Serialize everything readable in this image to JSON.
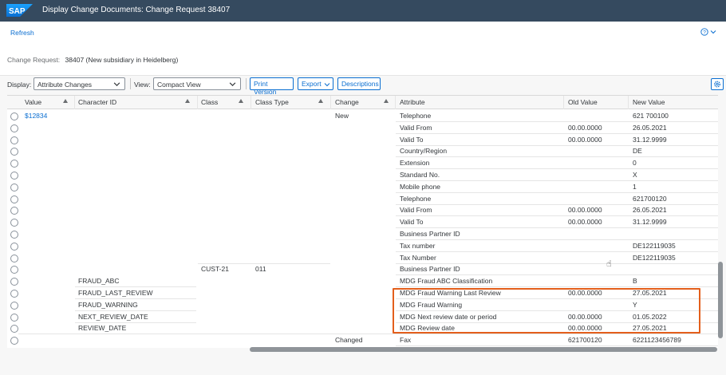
{
  "app": {
    "title": "Display Change Documents: Change Request 38407",
    "logo_text": "SAP"
  },
  "toolbar": {
    "refresh_label": "Refresh",
    "help_icon": "help-icon"
  },
  "change_request": {
    "label": "Change Request:",
    "value": "38407 (New subsidiary in Heidelberg)"
  },
  "filters": {
    "display_label": "Display:",
    "display_value": "Attribute Changes",
    "view_label": "View:",
    "view_value": "Compact View",
    "print_label": "Print Version",
    "export_label": "Export",
    "descriptions_label": "Descriptions"
  },
  "table": {
    "columns": [
      "Value",
      "Character ID",
      "Class",
      "Class Type",
      "Change",
      "Attribute",
      "Old Value",
      "New Value"
    ],
    "rows": [
      {
        "value": "$12834",
        "char": "",
        "class": "",
        "ctype": "",
        "change": "New",
        "attr": "Telephone",
        "old": "",
        "new": "621 700100"
      },
      {
        "value": "",
        "char": "",
        "class": "",
        "ctype": "",
        "change": "",
        "attr": "Valid From",
        "old": "00.00.0000",
        "new": "26.05.2021"
      },
      {
        "value": "",
        "char": "",
        "class": "",
        "ctype": "",
        "change": "",
        "attr": "Valid To",
        "old": "00.00.0000",
        "new": "31.12.9999"
      },
      {
        "value": "",
        "char": "",
        "class": "",
        "ctype": "",
        "change": "",
        "attr": "Country/Region",
        "old": "",
        "new": "DE"
      },
      {
        "value": "",
        "char": "",
        "class": "",
        "ctype": "",
        "change": "",
        "attr": "Extension",
        "old": "",
        "new": "0"
      },
      {
        "value": "",
        "char": "",
        "class": "",
        "ctype": "",
        "change": "",
        "attr": "Standard No.",
        "old": "",
        "new": "X"
      },
      {
        "value": "",
        "char": "",
        "class": "",
        "ctype": "",
        "change": "",
        "attr": "Mobile phone",
        "old": "",
        "new": "1"
      },
      {
        "value": "",
        "char": "",
        "class": "",
        "ctype": "",
        "change": "",
        "attr": "Telephone",
        "old": "",
        "new": "621700120"
      },
      {
        "value": "",
        "char": "",
        "class": "",
        "ctype": "",
        "change": "",
        "attr": "Valid From",
        "old": "00.00.0000",
        "new": "26.05.2021"
      },
      {
        "value": "",
        "char": "",
        "class": "",
        "ctype": "",
        "change": "",
        "attr": "Valid To",
        "old": "00.00.0000",
        "new": "31.12.9999"
      },
      {
        "value": "",
        "char": "",
        "class": "",
        "ctype": "",
        "change": "",
        "attr": "Business Partner ID",
        "old": "",
        "new": ""
      },
      {
        "value": "",
        "char": "",
        "class": "",
        "ctype": "",
        "change": "",
        "attr": "Tax number",
        "old": "",
        "new": "DE122119035"
      },
      {
        "value": "",
        "char": "",
        "class": "",
        "ctype": "",
        "change": "",
        "attr": "Tax Number",
        "old": "",
        "new": "DE122119035"
      },
      {
        "value": "",
        "char": "",
        "class": "CUST-21",
        "ctype": "011",
        "change": "",
        "attr": "Business Partner ID",
        "old": "",
        "new": ""
      },
      {
        "value": "",
        "char": "FRAUD_ABC",
        "class": "",
        "ctype": "",
        "change": "",
        "attr": "MDG Fraud ABC Classification",
        "old": "",
        "new": "B"
      },
      {
        "value": "",
        "char": "FRAUD_LAST_REVIEW",
        "class": "",
        "ctype": "",
        "change": "",
        "attr": "MDG Fraud Warning Last Review",
        "old": "00.00.0000",
        "new": "27.05.2021"
      },
      {
        "value": "",
        "char": "FRAUD_WARNING",
        "class": "",
        "ctype": "",
        "change": "",
        "attr": "MDG Fraud Warning",
        "old": "",
        "new": "Y"
      },
      {
        "value": "",
        "char": "NEXT_REVIEW_DATE",
        "class": "",
        "ctype": "",
        "change": "",
        "attr": "MDG Next review date or period",
        "old": "00.00.0000",
        "new": "01.05.2022"
      },
      {
        "value": "",
        "char": "REVIEW_DATE",
        "class": "",
        "ctype": "",
        "change": "",
        "attr": "MDG Review date",
        "old": "00.00.0000",
        "new": "27.05.2021"
      },
      {
        "value": "",
        "char": "",
        "class": "",
        "ctype": "",
        "change": "Changed",
        "attr": "Fax",
        "old": "621700120",
        "new": "6221123456789"
      }
    ]
  },
  "colors": {
    "shell": "#354a5f",
    "link": "#0a6ed1",
    "highlight": "#e35f1c"
  }
}
